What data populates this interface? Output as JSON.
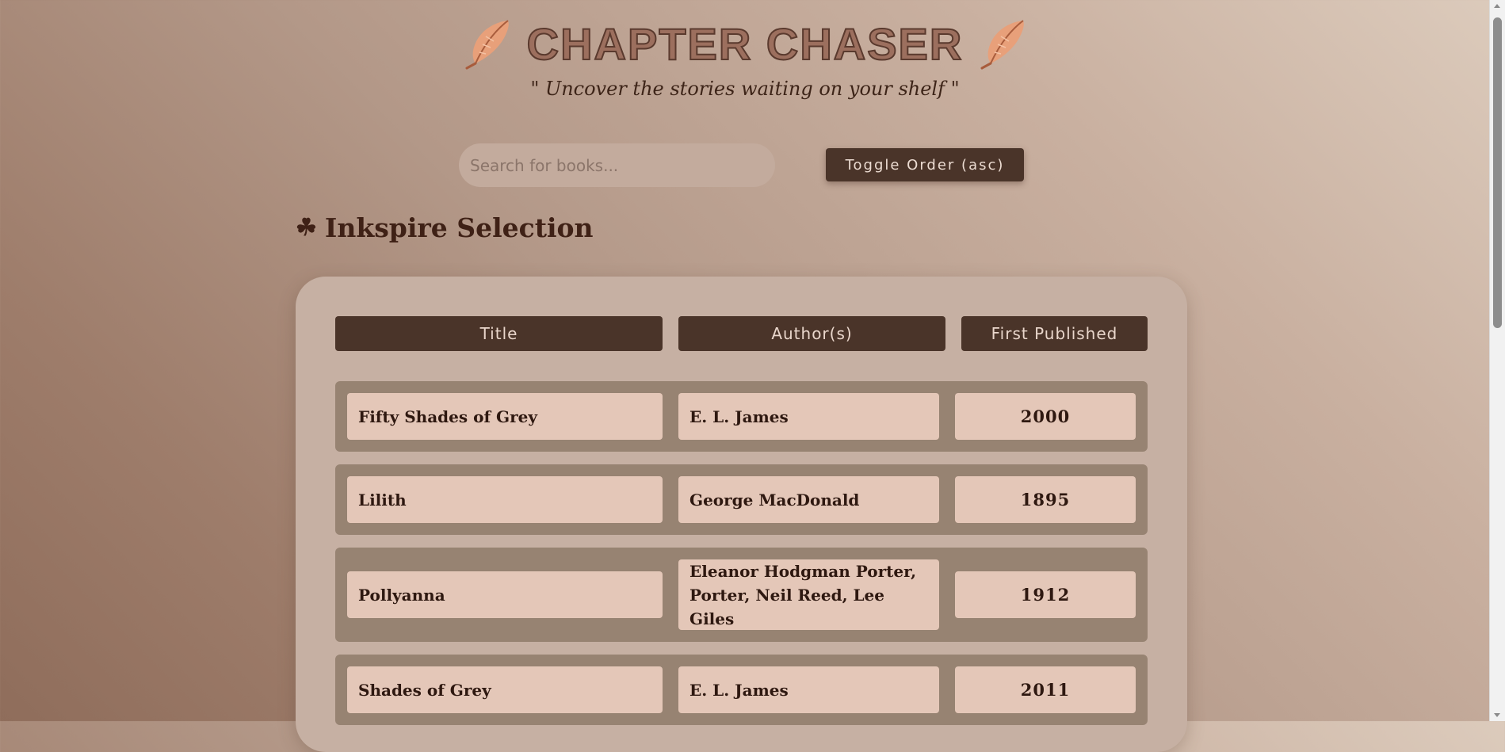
{
  "header": {
    "title": "CHAPTER CHASER",
    "tagline": "\" Uncover the stories waiting on your shelf \"",
    "left_icon": "feather-icon",
    "right_icon": "feather-icon"
  },
  "controls": {
    "search_placeholder": "Search for books...",
    "search_value": "",
    "toggle_label": "Toggle Order (asc)"
  },
  "section": {
    "icon": "☘",
    "title": "Inkspire Selection"
  },
  "table": {
    "headers": [
      "Title",
      "Author(s)",
      "First Published"
    ],
    "rows": [
      {
        "title": "Fifty Shades of Grey",
        "authors": [
          "E. L. James"
        ],
        "year": "2000"
      },
      {
        "title": "Lilith",
        "authors": [
          "George MacDonald"
        ],
        "year": "1895"
      },
      {
        "title": "Pollyanna",
        "authors": [
          "Eleanor Hodgman Porter,",
          "Porter, Neil Reed, Lee Giles"
        ],
        "year": "1912"
      },
      {
        "title": "Shades of Grey",
        "authors": [
          "E. L. James"
        ],
        "year": "2011"
      }
    ]
  },
  "colors": {
    "accent_dark": "#4a3429",
    "card": "#c6b0a3",
    "row": "#978372",
    "cell": "#e4c7b8"
  }
}
